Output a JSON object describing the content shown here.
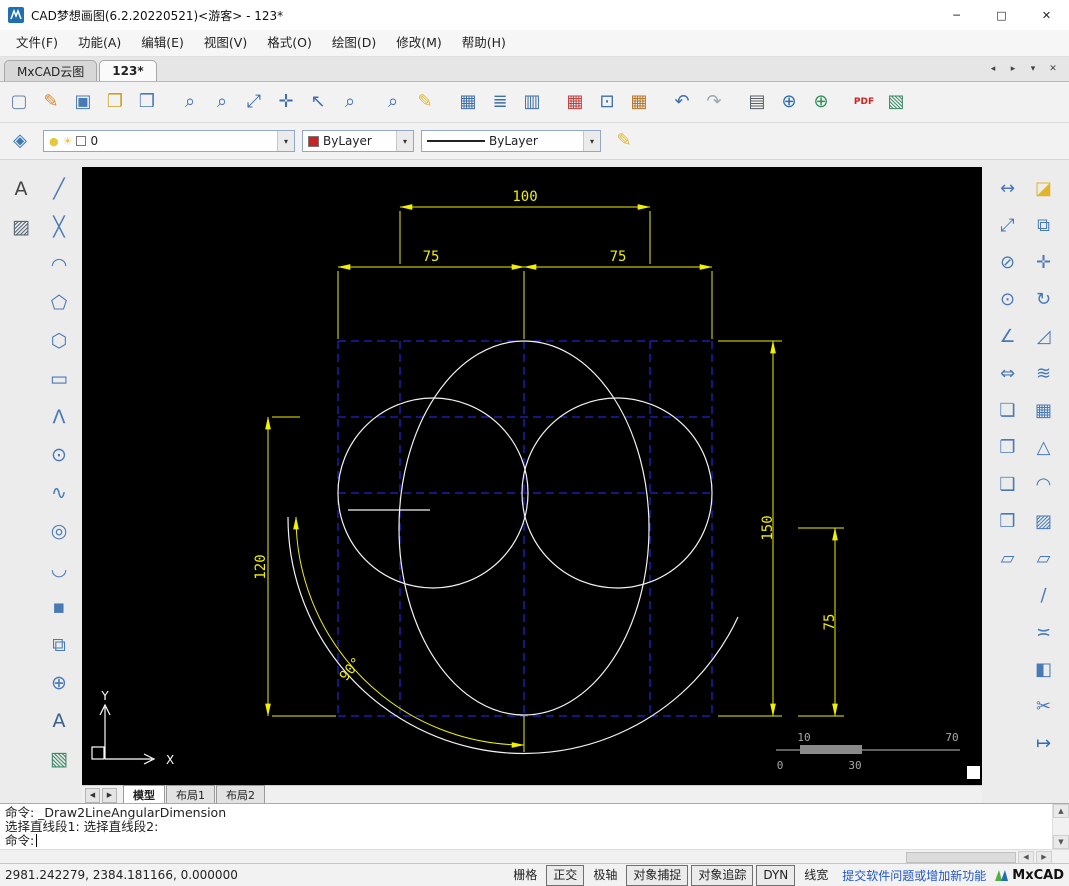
{
  "window": {
    "title": "CAD梦想画图(6.2.20220521)<游客> - 123*",
    "minimize": "─",
    "maximize": "□",
    "close": "✕"
  },
  "menu": {
    "items": [
      {
        "name": "menu-file",
        "label": "文件(F)"
      },
      {
        "name": "menu-function",
        "label": "功能(A)"
      },
      {
        "name": "menu-edit",
        "label": "编辑(E)"
      },
      {
        "name": "menu-view",
        "label": "视图(V)"
      },
      {
        "name": "menu-format",
        "label": "格式(O)"
      },
      {
        "name": "menu-draw",
        "label": "绘图(D)"
      },
      {
        "name": "menu-modify",
        "label": "修改(M)"
      },
      {
        "name": "menu-help",
        "label": "帮助(H)"
      }
    ]
  },
  "doc_tabs": {
    "tabs": [
      {
        "name": "tab-mxcad-cloud",
        "label": "MxCAD云图",
        "active": false
      },
      {
        "name": "tab-123",
        "label": "123*",
        "active": true
      }
    ],
    "controls": [
      {
        "name": "tab-scroll-left-button",
        "glyph": "◂"
      },
      {
        "name": "tab-scroll-right-button",
        "glyph": "▸"
      },
      {
        "name": "tab-list-button",
        "glyph": "▾"
      },
      {
        "name": "tab-close-button",
        "glyph": "✕"
      }
    ]
  },
  "toolbar_main": {
    "buttons": [
      {
        "name": "new-file-button",
        "icon": "new-file-icon",
        "glyph": "▢",
        "color": "#6e87aa"
      },
      {
        "name": "open-drawing-button",
        "icon": "open-drawing-icon",
        "glyph": "✎",
        "color": "#d8882b"
      },
      {
        "name": "save-button",
        "icon": "save-icon",
        "glyph": "▣",
        "color": "#4a7ab5"
      },
      {
        "name": "open-folder-button",
        "icon": "folder-icon",
        "glyph": "❐",
        "color": "#c9a227"
      },
      {
        "name": "save-as-button",
        "icon": "save-as-icon",
        "glyph": "❒",
        "color": "#4a7ab5"
      },
      {
        "name": "zoom-previous-button",
        "icon": "zoom-previous-icon",
        "glyph": "⌕",
        "color": "#3f6fa8"
      },
      {
        "name": "zoom-window-button",
        "icon": "zoom-window-icon",
        "glyph": "⌕",
        "color": "#3f6fa8"
      },
      {
        "name": "zoom-extents-button",
        "icon": "zoom-extents-icon",
        "glyph": "⤢",
        "color": "#3f6fa8"
      },
      {
        "name": "pan-button",
        "icon": "pan-icon",
        "glyph": "✛",
        "color": "#3f6fa8"
      },
      {
        "name": "zoom-scale-button",
        "icon": "zoom-scale-icon",
        "glyph": "↖",
        "color": "#3f6fa8"
      },
      {
        "name": "zoom-in-button",
        "icon": "zoom-in-icon",
        "glyph": "⌕",
        "color": "#3f6fa8"
      },
      {
        "name": "zoom-object-button",
        "icon": "zoom-object-icon",
        "glyph": "⌕",
        "color": "#3f6fa8"
      },
      {
        "name": "sketch-button",
        "icon": "pencil-icon",
        "glyph": "✎",
        "color": "#e3b72e"
      },
      {
        "name": "insert-table-button",
        "icon": "table-icon",
        "glyph": "▦",
        "color": "#3f6fa8"
      },
      {
        "name": "text-lines-button",
        "icon": "text-lines-icon",
        "glyph": "≣",
        "color": "#3f6fa8"
      },
      {
        "name": "copy-view-button",
        "icon": "copy-view-icon",
        "glyph": "▥",
        "color": "#3f6fa8"
      },
      {
        "name": "color-table-button",
        "icon": "color-table-icon",
        "glyph": "▦",
        "color": "#c04040"
      },
      {
        "name": "select-set-button",
        "icon": "select-set-icon",
        "glyph": "⊡",
        "color": "#3f6fa8"
      },
      {
        "name": "table-edit-button",
        "icon": "table-edit-icon",
        "glyph": "▦",
        "color": "#b5762a"
      },
      {
        "name": "undo-button",
        "icon": "undo-icon",
        "glyph": "↶",
        "color": "#3f6fa8"
      },
      {
        "name": "redo-button",
        "icon": "redo-icon",
        "glyph": "↷",
        "color": "#9aa6b2"
      },
      {
        "name": "print-button",
        "icon": "print-icon",
        "glyph": "▤",
        "color": "#5a5f66"
      },
      {
        "name": "publish-web-button",
        "icon": "globe-icon",
        "glyph": "⊕",
        "color": "#2c6fb0"
      },
      {
        "name": "browse-web-button",
        "icon": "globe2-icon",
        "glyph": "⊕",
        "color": "#2f8f5a"
      },
      {
        "name": "export-pdf-button",
        "icon": "pdf-icon",
        "glyph": "PDF",
        "color": "#cc2222",
        "small": true
      },
      {
        "name": "insert-image-button",
        "icon": "image-icon",
        "glyph": "▧",
        "color": "#3a8a66"
      }
    ]
  },
  "properties_bar": {
    "layers_button": {
      "glyph": "◈",
      "color": "#3a7ab8"
    },
    "layer_combo": {
      "icons": [
        {
          "glyph": "●",
          "color": "#e8c73a"
        },
        {
          "glyph": "☀",
          "color": "#e8c73a"
        }
      ],
      "value": "0",
      "caret": "▾"
    },
    "color_combo": {
      "swatch": "#cc2222",
      "value": "ByLayer",
      "caret": "▾"
    },
    "linetype_combo": {
      "value": "ByLayer",
      "caret": "▾"
    },
    "match_button": {
      "glyph": "✎",
      "color": "#e3b72e"
    }
  },
  "left_toolbar": {
    "buttons": [
      {
        "name": "text-style-button",
        "icon": "text-style-icon",
        "glyph": "A",
        "color": "#444444"
      },
      {
        "name": "line-button",
        "icon": "line-icon",
        "glyph": "╱",
        "color": "#4a7ab5"
      },
      {
        "name": "hatch-button",
        "icon": "hatch-icon",
        "glyph": "▨",
        "color": "#556677"
      },
      {
        "name": "construction-line-button",
        "icon": "construction-line-icon",
        "glyph": "╳",
        "color": "#4a7ab5"
      },
      {
        "name": "arc-button",
        "icon": "arc-icon",
        "glyph": "◠",
        "color": "#4a7ab5"
      },
      {
        "name": "polygon-button",
        "icon": "polygon-icon",
        "glyph": "⬠",
        "color": "#4a7ab5"
      },
      {
        "name": "inscribed-polygon-button",
        "icon": "inscribed-polygon-icon",
        "glyph": "⬡",
        "color": "#4a7ab5"
      },
      {
        "name": "rectangle-button",
        "icon": "rectangle-icon",
        "glyph": "▭",
        "color": "#4a7ab5"
      },
      {
        "name": "polyline-button",
        "icon": "polyline-icon",
        "glyph": "Λ",
        "color": "#4a7ab5"
      },
      {
        "name": "circle-button",
        "icon": "circle-icon",
        "glyph": "⊙",
        "color": "#4a7ab5"
      },
      {
        "name": "spline-button",
        "icon": "spline-icon",
        "glyph": "∿",
        "color": "#4a7ab5"
      },
      {
        "name": "ellipse-button",
        "icon": "ellipse-icon",
        "glyph": "◎",
        "color": "#4a7ab5"
      },
      {
        "name": "arc-3point-button",
        "icon": "arc-3point-icon",
        "glyph": "◡",
        "color": "#4a7ab5"
      },
      {
        "name": "point-button",
        "icon": "point-icon",
        "glyph": "▪",
        "color": "#4a7ab5"
      },
      {
        "name": "block-button",
        "icon": "block-icon",
        "glyph": "⧉",
        "color": "#4a7ab5"
      },
      {
        "name": "insert-block-button",
        "icon": "insert-block-icon",
        "glyph": "⊕",
        "color": "#4a7ab5"
      },
      {
        "name": "mtext-button",
        "icon": "mtext-icon",
        "glyph": "A",
        "color": "#3a5f8a"
      },
      {
        "name": "image-button",
        "icon": "image2-icon",
        "glyph": "▧",
        "color": "#3a8a66"
      }
    ]
  },
  "right_toolbar_dim": {
    "buttons": [
      {
        "name": "dim-linear-button",
        "icon": "dim-linear-icon",
        "glyph": "↔",
        "color": "#4a7ab5"
      },
      {
        "name": "dim-aligned-button",
        "icon": "dim-aligned-icon",
        "glyph": "⤢",
        "color": "#4a7ab5"
      },
      {
        "name": "dim-diameter-button",
        "icon": "dim-diameter-icon",
        "glyph": "⊘",
        "color": "#4a7ab5"
      },
      {
        "name": "dim-radius-button",
        "icon": "dim-radius-icon",
        "glyph": "⊙",
        "color": "#4a7ab5"
      },
      {
        "name": "dim-angular-button",
        "icon": "dim-angular-icon",
        "glyph": "∠",
        "color": "#4a7ab5"
      },
      {
        "name": "dim-continue-button",
        "icon": "dim-continue-icon",
        "glyph": "⇔",
        "color": "#4a7ab5"
      },
      {
        "name": "draw-order-front-button",
        "icon": "draw-order-front-icon",
        "glyph": "❏",
        "color": "#4a7ab5"
      },
      {
        "name": "draw-order-back-button",
        "icon": "draw-order-back-icon",
        "glyph": "❐",
        "color": "#4a7ab5"
      },
      {
        "name": "draw-order-above-button",
        "icon": "draw-order-above-icon",
        "glyph": "❑",
        "color": "#4a7ab5"
      },
      {
        "name": "draw-order-below-button",
        "icon": "draw-order-below-icon",
        "glyph": "❒",
        "color": "#4a7ab5"
      },
      {
        "name": "wipeout-button",
        "icon": "wipeout-icon",
        "glyph": "▱",
        "color": "#4a7ab5"
      }
    ]
  },
  "right_toolbar_modify": {
    "buttons": [
      {
        "name": "erase-button",
        "icon": "erase-icon",
        "glyph": "◪",
        "color": "#e0b52a"
      },
      {
        "name": "copy-button",
        "icon": "copy-icon",
        "glyph": "⧉",
        "color": "#4a7ab5"
      },
      {
        "name": "move-button",
        "icon": "move-icon",
        "glyph": "✛",
        "color": "#4a7ab5"
      },
      {
        "name": "rotate-button",
        "icon": "rotate-icon",
        "glyph": "↻",
        "color": "#4a7ab5"
      },
      {
        "name": "scale-button",
        "icon": "scale-icon",
        "glyph": "◿",
        "color": "#4a7ab5"
      },
      {
        "name": "offset-button",
        "icon": "offset-icon",
        "glyph": "≋",
        "color": "#4a7ab5"
      },
      {
        "name": "array-button",
        "icon": "array-icon",
        "glyph": "▦",
        "color": "#4a7ab5"
      },
      {
        "name": "mirror-button",
        "icon": "mirror-icon",
        "glyph": "△",
        "color": "#4a7ab5"
      },
      {
        "name": "fillet-button",
        "icon": "fillet-icon",
        "glyph": "◠",
        "color": "#4a7ab5"
      },
      {
        "name": "hatch-edit-button",
        "icon": "hatch-edit-icon",
        "glyph": "▨",
        "color": "#4a7ab5"
      },
      {
        "name": "boundary-button",
        "icon": "boundary-icon",
        "glyph": "▱",
        "color": "#4a7ab5"
      },
      {
        "name": "break-button",
        "icon": "break-icon",
        "glyph": "∕",
        "color": "#4a7ab5"
      },
      {
        "name": "join-button",
        "icon": "join-icon",
        "glyph": "≍",
        "color": "#4a7ab5"
      },
      {
        "name": "box-3d-button",
        "icon": "box-3d-icon",
        "glyph": "◧",
        "color": "#4a7ab5"
      },
      {
        "name": "trim-button",
        "icon": "trim-icon",
        "glyph": "✂",
        "color": "#4a7ab5"
      },
      {
        "name": "extend-button",
        "icon": "extend-icon",
        "glyph": "↦",
        "color": "#2c6fb0"
      }
    ]
  },
  "canvas": {
    "dims": {
      "top": "100",
      "left_75": "75",
      "right_75": "75",
      "left_120": "120",
      "right_150": "150",
      "small_75": "75",
      "angle": "90°"
    },
    "ucs": {
      "x": "X",
      "y": "Y"
    },
    "scalebar": {
      "n10": "10",
      "n70": "70",
      "n0": "0",
      "n30": "30"
    }
  },
  "layout_tabs": {
    "scroll_left": "◀",
    "scroll_right": "▶",
    "tabs": [
      {
        "name": "layout-tab-model",
        "label": "模型",
        "active": true
      },
      {
        "name": "layout-tab-1",
        "label": "布局1",
        "active": false
      },
      {
        "name": "layout-tab-2",
        "label": "布局2",
        "active": false
      }
    ]
  },
  "command": {
    "history": [
      {
        "text": "命令: _Draw2LineAngularDimension"
      },
      {
        "text": "选择直线段1: 选择直线段2:"
      }
    ],
    "prompt": "命令:",
    "scroll_up": "▲",
    "scroll_down": "▼",
    "scroll_left": "◀",
    "scroll_right": "▶"
  },
  "status_bar": {
    "coordinates": "2981.242279, 2384.181166, 0.000000",
    "toggles": [
      {
        "name": "toggle-grid",
        "label": "栅格",
        "active": false
      },
      {
        "name": "toggle-ortho",
        "label": "正交",
        "active": true
      },
      {
        "name": "toggle-polar",
        "label": "极轴",
        "active": false
      },
      {
        "name": "toggle-osnap",
        "label": "对象捕捉",
        "active": true
      },
      {
        "name": "toggle-otrack",
        "label": "对象追踪",
        "active": true
      },
      {
        "name": "toggle-dyn",
        "label": "DYN",
        "active": true
      },
      {
        "name": "toggle-lineweight",
        "label": "线宽",
        "active": false
      }
    ],
    "feedback_link": "提交软件问题或增加新功能",
    "brand": "MxCAD"
  }
}
